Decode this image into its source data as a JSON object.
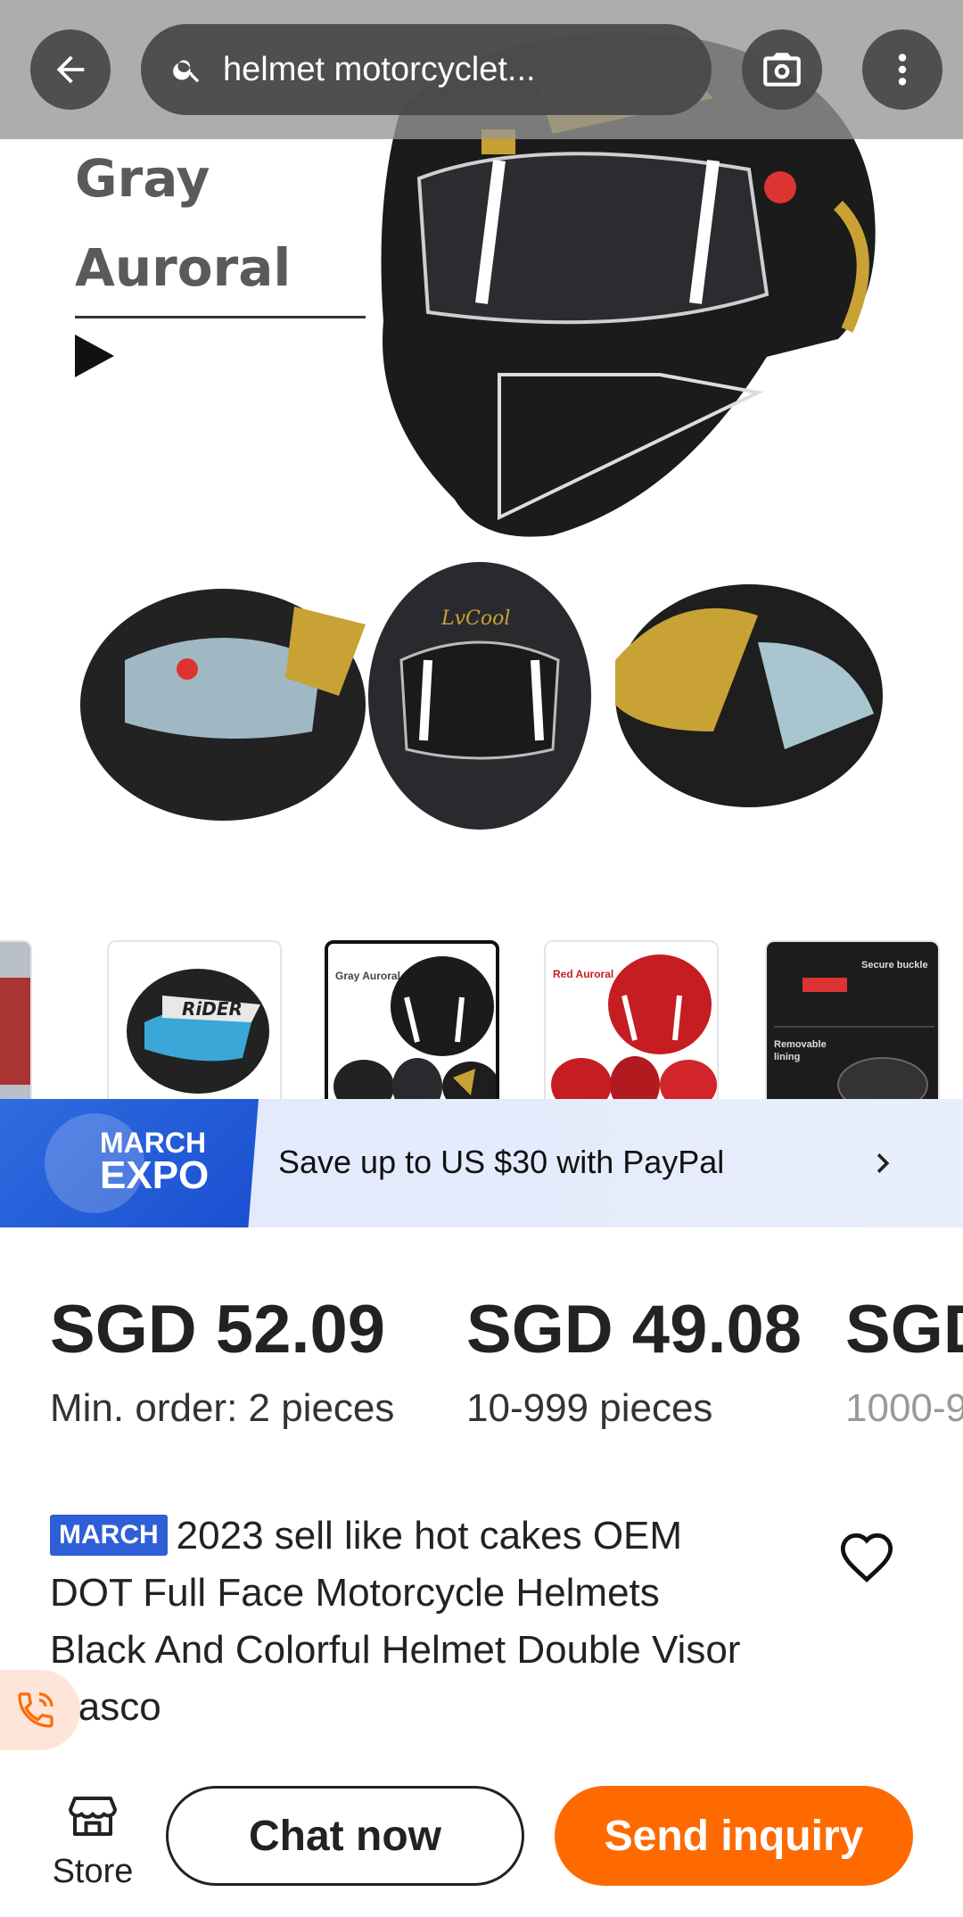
{
  "header": {
    "search_query": "helmet motorcyclet...",
    "back_icon": "back-arrow-icon",
    "camera_icon": "camera-icon",
    "more_icon": "more-vertical-icon"
  },
  "hero": {
    "caption_line1": "Gray",
    "caption_line2": "Auroral",
    "logo_text": "LvCool"
  },
  "thumbnails": [
    {
      "caption": "",
      "selected": false
    },
    {
      "caption": "RiDER",
      "selected": false
    },
    {
      "caption": "Gray Auroral",
      "selected": true
    },
    {
      "caption": "Red Auroral",
      "selected": false
    },
    {
      "caption": "Secure buckle",
      "caption2": "Removable lining",
      "selected": false
    }
  ],
  "promo": {
    "badge_line1": "MARCH",
    "badge_line2": "EXPO",
    "text": "Save up to US $30 with PayPal"
  },
  "price_tiers": [
    {
      "price": "SGD 52.09",
      "quantity": "Min. order: 2 pieces"
    },
    {
      "price": "SGD 49.08",
      "quantity": "10-999 pieces"
    },
    {
      "price": "SGD",
      "quantity": "1000-9"
    }
  ],
  "product": {
    "badge": "MARCH",
    "title": "2023 sell like hot cakes OEM DOT Full Face Motorcycle Helmets Black And Colorful Helmet Double Visor Casco"
  },
  "bottom_bar": {
    "store_label": "Store",
    "chat_label": "Chat now",
    "inquiry_label": "Send inquiry"
  },
  "colors": {
    "accent": "#ff6a00",
    "promo_blue": "#1a4fd0",
    "march_badge": "#2f5fd6"
  }
}
